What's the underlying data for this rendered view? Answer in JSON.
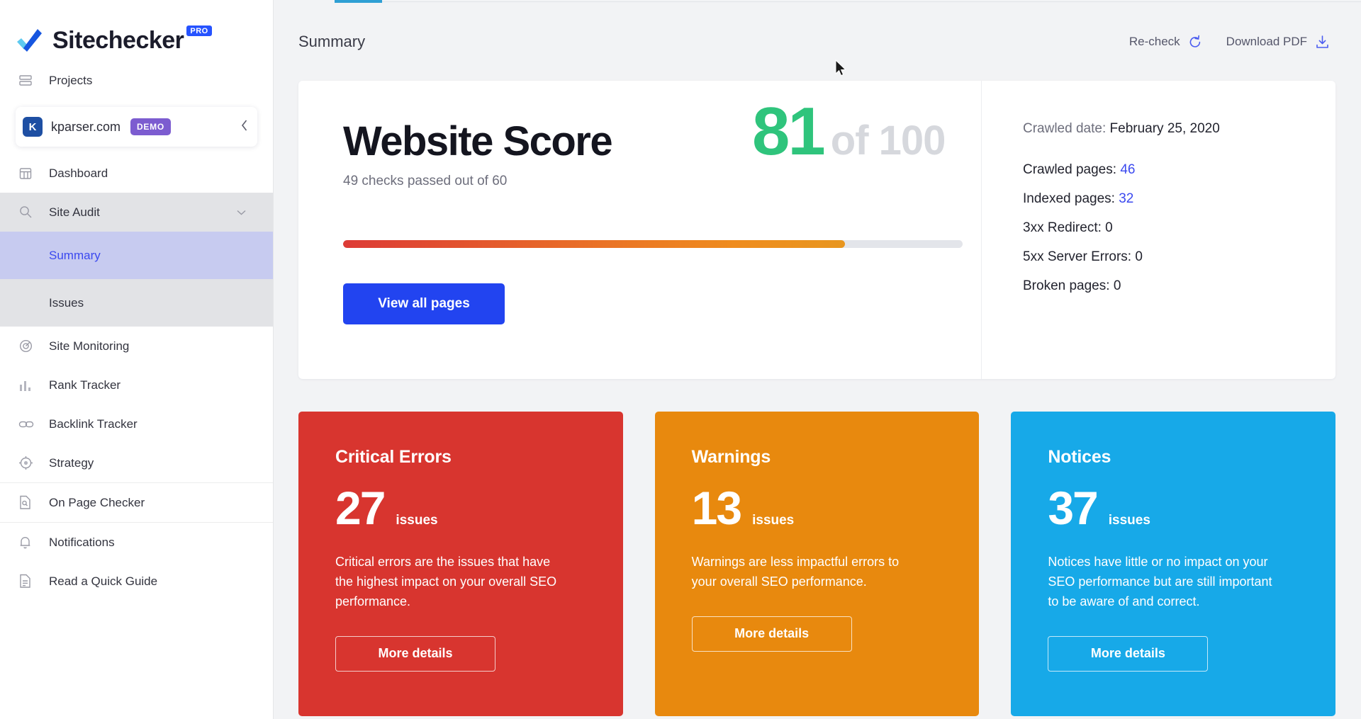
{
  "brand": {
    "name": "Sitechecker",
    "plan_badge": "PRO",
    "logo_icon": "checkmark-logo"
  },
  "sidebar": {
    "projects_label": "Projects",
    "projects_icon": "projects-icon",
    "project": {
      "favicon_letter": "K",
      "domain": "kparser.com",
      "badge": "DEMO",
      "collapse_icon": "chevron-left-icon"
    },
    "items": [
      {
        "label": "Dashboard",
        "icon": "dashboard-icon"
      },
      {
        "label": "Site Audit",
        "icon": "magnifier-icon",
        "chevron": "chevron-down-icon",
        "expanded": true
      },
      {
        "label": "Site Monitoring",
        "icon": "monitoring-icon"
      },
      {
        "label": "Rank Tracker",
        "icon": "bar-chart-icon"
      },
      {
        "label": "Backlink Tracker",
        "icon": "link-icon"
      },
      {
        "label": "Strategy",
        "icon": "target-icon"
      },
      {
        "label": "On Page Checker",
        "icon": "page-icon"
      },
      {
        "label": "Notifications",
        "icon": "bell-icon"
      },
      {
        "label": "Read a Quick Guide",
        "icon": "document-icon"
      }
    ],
    "sub_items": [
      {
        "label": "Summary",
        "active": true
      },
      {
        "label": "Issues",
        "active": false
      }
    ]
  },
  "header": {
    "title": "Summary",
    "recheck_label": "Re-check",
    "recheck_icon": "refresh-icon",
    "download_label": "Download PDF",
    "download_icon": "download-icon"
  },
  "score_card": {
    "heading": "Website Score",
    "subheading": "49 checks passed out of 60",
    "score": "81",
    "score_of": "of 100",
    "progress_percent": 81,
    "view_all_label": "View all pages",
    "crawled_date_label": "Crawled date:",
    "crawled_date_value": "February 25, 2020",
    "stats": [
      {
        "label": "Crawled pages:",
        "value": "46",
        "link": true
      },
      {
        "label": "Indexed pages:",
        "value": "32",
        "link": true
      },
      {
        "label": "3xx Redirect:",
        "value": "0",
        "link": false
      },
      {
        "label": "5xx Server Errors:",
        "value": "0",
        "link": false
      },
      {
        "label": "Broken pages:",
        "value": "0",
        "link": false
      }
    ]
  },
  "issue_cards": [
    {
      "title": "Critical Errors",
      "count": "27",
      "unit": "issues",
      "description": "Critical errors are the issues that have the highest impact on your overall SEO performance.",
      "button": "More details",
      "color": "#d8352f"
    },
    {
      "title": "Warnings",
      "count": "13",
      "unit": "issues",
      "description": "Warnings are less impactful errors to your overall SEO performance.",
      "button": "More details",
      "color": "#e8890e"
    },
    {
      "title": "Notices",
      "count": "37",
      "unit": "issues",
      "description": "Notices have little or no impact on your SEO performance but are still important to be aware of and correct.",
      "button": "More details",
      "color": "#17a9e8"
    }
  ],
  "colors": {
    "accent_blue": "#2244f0",
    "link_blue": "#3b49ef",
    "score_green": "#2fc47c",
    "tab_underline": "#2f9fd4",
    "demo_purple": "#7c5cd0"
  }
}
